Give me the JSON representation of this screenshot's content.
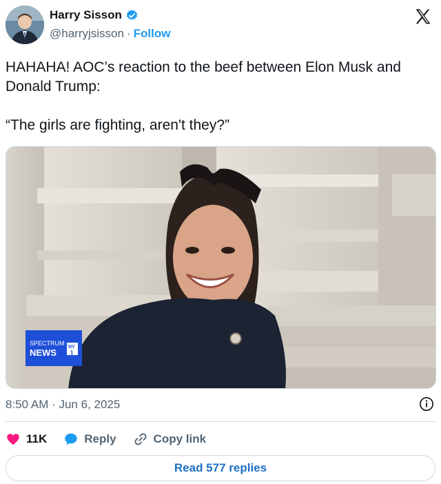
{
  "author": {
    "name": "Harry Sisson",
    "handle": "@harryjsisson",
    "separator": "·",
    "follow_label": "Follow",
    "avatar_icon": "avatar-photo",
    "verified_icon": "verified-badge-icon",
    "verified_color": "#1d9bf0"
  },
  "platform": {
    "logo_icon": "x-logo-icon"
  },
  "tweet": {
    "text_line1": "HAHAHA! AOC’s reaction to the beef between Elon Musk and Donald Trump:",
    "text_line2": "“The girls are fighting, aren't they?”"
  },
  "media": {
    "type": "video-still",
    "watermark_line1": "SPECTRUM",
    "watermark_line2": "NEWS",
    "watermark_badge_top": "NY",
    "watermark_badge_bottom": "1",
    "watermark_color": "#1e4fd8"
  },
  "meta": {
    "timestamp": "8:50 AM · Jun 6, 2025",
    "info_icon": "info-icon"
  },
  "actions": {
    "like_count": "11K",
    "like_color": "#f91880",
    "reply_label": "Reply",
    "reply_icon_color": "#1d9bf0",
    "copy_link_label": "Copy link"
  },
  "read_replies_label": "Read 577 replies"
}
